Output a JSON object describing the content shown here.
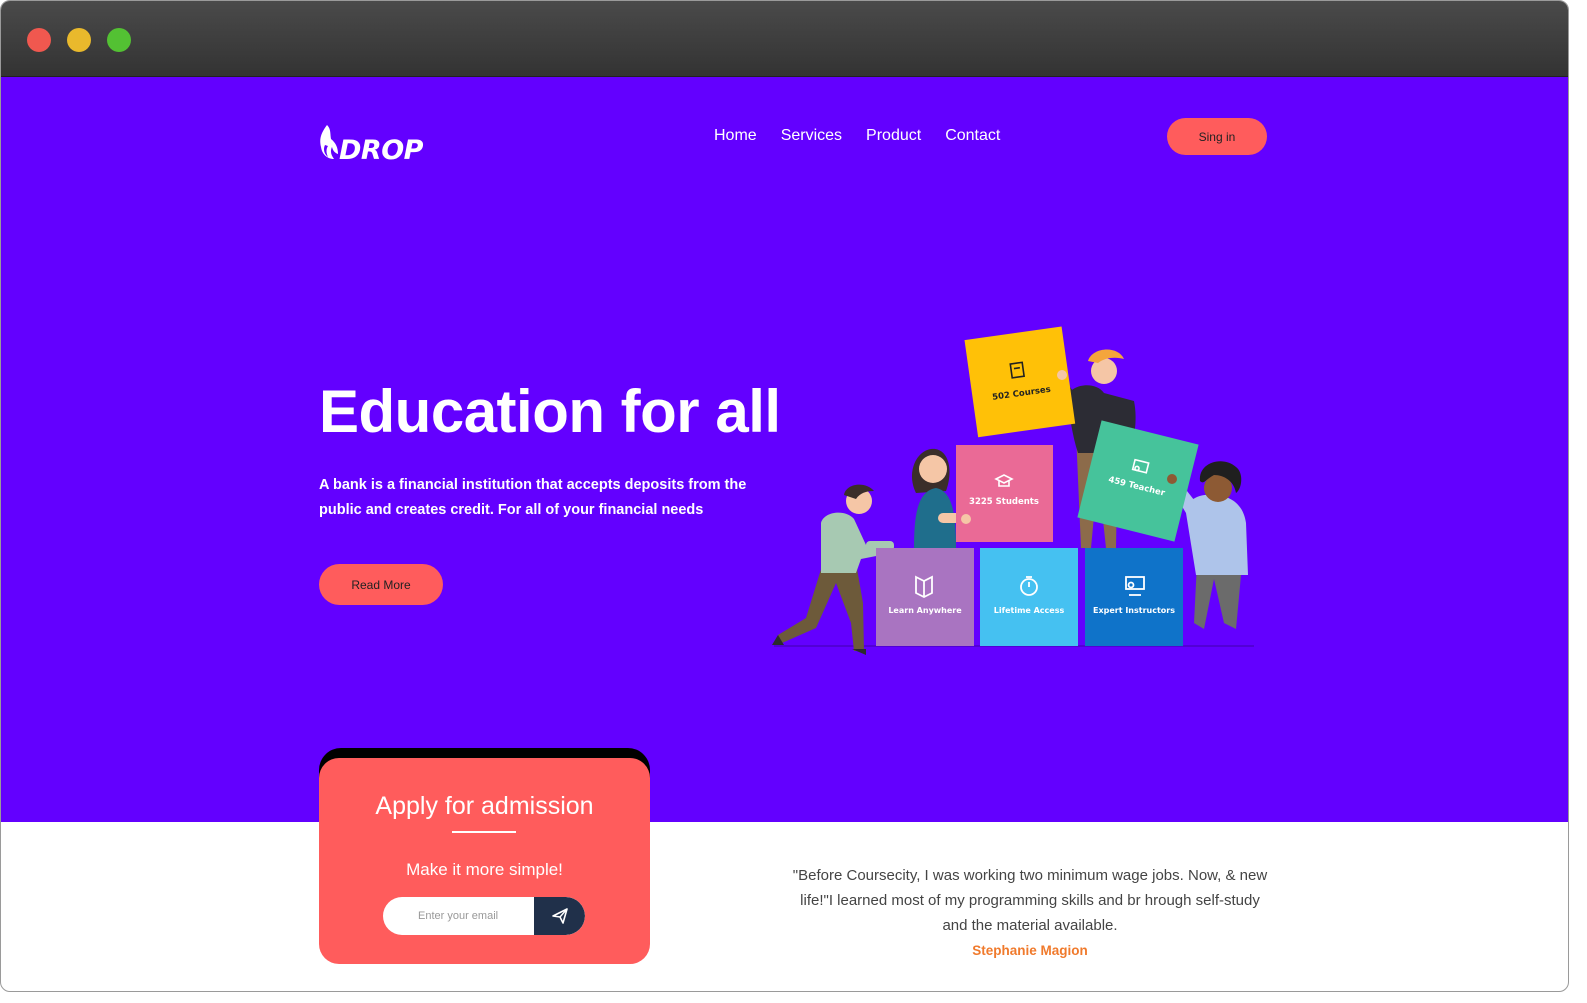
{
  "brand": {
    "logo_text": "DROP"
  },
  "nav": {
    "items": [
      {
        "label": "Home"
      },
      {
        "label": "Services"
      },
      {
        "label": "Product"
      },
      {
        "label": "Contact"
      }
    ],
    "signin_label": "Sing in"
  },
  "hero": {
    "title": "Education for all",
    "description": "A bank is a financial institution that accepts deposits from the public and creates credit. For all of your financial needs",
    "cta_label": "Read More"
  },
  "illustration": {
    "blocks": [
      {
        "label": "502 Courses",
        "color": "#ffc107",
        "icon": "book-icon"
      },
      {
        "label": "3225 Students",
        "color": "#ea6a96",
        "icon": "graduation-cap-icon"
      },
      {
        "label": "459 Teacher",
        "color": "#46c39b",
        "icon": "teacher-board-icon"
      },
      {
        "label": "Learn Anywhere",
        "color": "#a974c1",
        "icon": "open-book-icon"
      },
      {
        "label": "Lifetime Access",
        "color": "#45c1f1",
        "icon": "stopwatch-icon"
      },
      {
        "label": "Expert Instructors",
        "color": "#0f73c9",
        "icon": "presentation-icon"
      }
    ]
  },
  "admission": {
    "title": "Apply for admission",
    "subtitle": "Make it more simple!",
    "email_placeholder": "Enter your email"
  },
  "testimonial": {
    "quote": "\"Before Coursecity, I was working two minimum wage jobs. Now, & new life!\"I learned most of my programming skills and br hrough self-study and the material available.",
    "author": "Stephanie Magion"
  },
  "colors": {
    "hero_bg": "#6300ff",
    "accent": "#ff5c5c",
    "author": "#f07a2c",
    "send_button": "#20304a"
  }
}
